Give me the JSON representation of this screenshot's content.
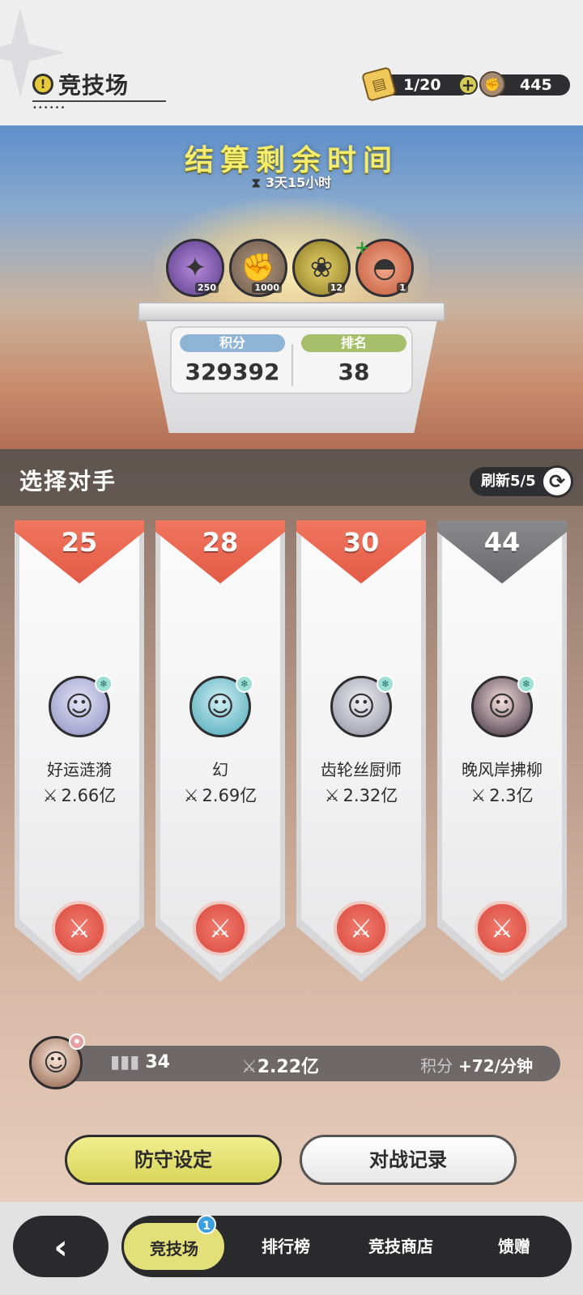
{
  "header": {
    "info_icon": "!",
    "title": "竞技场",
    "tickets": "1/20",
    "tickets_icon": "ticket-icon",
    "plus": "+",
    "coins": "445",
    "coins_icon": "fist-coin-icon"
  },
  "banner": {
    "settle_title": "结算剩余时间",
    "settle_time": "3天15小时",
    "rewards": [
      {
        "icon": "star-crystal-icon",
        "count": "250"
      },
      {
        "icon": "fist-coin-icon",
        "count": "1000"
      },
      {
        "icon": "purple-gift-icon",
        "count": "12"
      },
      {
        "icon": "cake-icon",
        "count": "1"
      }
    ],
    "score_label": "积分",
    "score_value": "329392",
    "rank_label": "排名",
    "rank_value": "38"
  },
  "arena": {
    "choose_title": "选择对手",
    "refresh_label": "刷新5/5",
    "opponents": [
      {
        "rank": "25",
        "name": "好运涟漪",
        "power": "2.66亿",
        "rank_color": "red"
      },
      {
        "rank": "28",
        "name": "幻",
        "power": "2.69亿",
        "rank_color": "red"
      },
      {
        "rank": "30",
        "name": "齿轮丝厨师",
        "power": "2.32亿",
        "rank_color": "red"
      },
      {
        "rank": "44",
        "name": "晚风岸拂柳",
        "power": "2.3亿",
        "rank_color": "grey"
      }
    ]
  },
  "me": {
    "rank": "34",
    "power": "2.22亿",
    "rate_label": "积分",
    "rate_value": "+72/分钟"
  },
  "actions": {
    "defense": "防守设定",
    "record": "对战记录"
  },
  "nav": {
    "back": "‹",
    "items": [
      "竞技场",
      "排行榜",
      "竞技商店",
      "馈赠"
    ],
    "badge": "1"
  },
  "colors": {
    "accent_yellow": "#e3e07a",
    "rank_red": "#e35a46",
    "rank_grey": "#6a6a6c",
    "score_blue": "#8eb4d6",
    "rank_green": "#a7bf6a"
  }
}
